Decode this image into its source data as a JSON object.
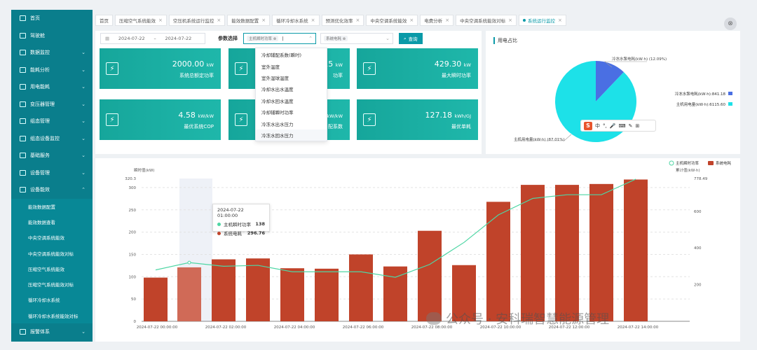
{
  "sidebar": {
    "items": [
      {
        "label": "首页",
        "icon": "home-icon"
      },
      {
        "label": "驾驶舱",
        "icon": "dashboard-icon"
      },
      {
        "label": "数据监控",
        "icon": "monitor-icon",
        "arrow": "⌄"
      },
      {
        "label": "能耗分析",
        "icon": "chart-icon",
        "arrow": "⌄"
      },
      {
        "label": "用电能耗",
        "icon": "power-icon",
        "arrow": "⌄"
      },
      {
        "label": "变压器管理",
        "icon": "transformer-icon",
        "arrow": "⌄"
      },
      {
        "label": "组态管理",
        "icon": "config-icon",
        "arrow": "⌄"
      },
      {
        "label": "组态设备监控",
        "icon": "device-icon",
        "arrow": "⌄"
      },
      {
        "label": "基础服务",
        "icon": "service-icon",
        "arrow": "⌄"
      },
      {
        "label": "设备管理",
        "icon": "equipment-icon",
        "arrow": "⌄"
      },
      {
        "label": "设备能效",
        "icon": "efficiency-icon",
        "arrow": "⌃"
      }
    ],
    "subitems": [
      {
        "label": "能效数据配置"
      },
      {
        "label": "能效数据查看"
      },
      {
        "label": "中央空调系统能效"
      },
      {
        "label": "中央空调系统能效对标"
      },
      {
        "label": "压缩空气系统能效"
      },
      {
        "label": "压缩空气系统能效对标"
      },
      {
        "label": "循环冷却水系统"
      },
      {
        "label": "循环冷却水系统能效对标"
      }
    ],
    "last": {
      "label": "报警体系",
      "icon": "alarm-icon",
      "arrow": "⌄"
    }
  },
  "tabs": [
    {
      "label": "首页",
      "close": ""
    },
    {
      "label": "压缩空气系统能效",
      "close": "×"
    },
    {
      "label": "空压机系统运行监控",
      "close": "×"
    },
    {
      "label": "能效数据配置",
      "close": "×"
    },
    {
      "label": "循环冷却水系统",
      "close": "×"
    },
    {
      "label": "预测优化效率",
      "close": "×"
    },
    {
      "label": "中央空调系统能效",
      "close": "×"
    },
    {
      "label": "电费分析",
      "close": "×"
    },
    {
      "label": "中央空调系统能效对标",
      "close": "×"
    },
    {
      "label": "系统运行监控",
      "close": "×",
      "active": true
    }
  ],
  "filters": {
    "start_date": "2024-07-22",
    "separator": "–",
    "end_date": "2024-07-22",
    "param_label": "参数选择",
    "param_chip": "主机瞬时功率 ⊗",
    "system_chip": "系统电耗 ⊗",
    "search_label": "查询"
  },
  "dropdown": {
    "options": [
      "冷却辅配系数(瞬时)",
      "室外温度",
      "室外湿球温度",
      "冷却水出水温度",
      "冷却水回水温度",
      "冷却辅瞬时功率",
      "冷冻水出水压力",
      "冷冻水回水压力"
    ]
  },
  "cards": [
    {
      "value": "2000.00",
      "unit": "kW",
      "label": "系统总额定功率"
    },
    {
      "value": "15",
      "unit": "kW",
      "label": "功率"
    },
    {
      "value": "429.30",
      "unit": "kW",
      "label": "最大瞬时功率"
    },
    {
      "value": "4.58",
      "unit": "kW/kW",
      "label": "最优系统COP"
    },
    {
      "value": "",
      "unit": "kW/kW",
      "label": "配系数"
    },
    {
      "value": "127.18",
      "unit": "kWh/GJ",
      "label": "最优单耗"
    }
  ],
  "pie": {
    "title": "用电占比",
    "label_small": "冷冻水泵电耗(kW·h) (12.09%)",
    "label_big": "主机用电量(kW·h) (87.01%)",
    "legend": [
      {
        "label": "冷冻水泵电耗(kW·h):841.18",
        "color": "#4a6fe3"
      },
      {
        "label": "主机用电量(kW·h):6115.60",
        "color": "#1de1e8"
      }
    ],
    "values": [
      841.18,
      6115.6
    ]
  },
  "ime": {
    "text": "中"
  },
  "chart_data": {
    "type": "bar",
    "legend": [
      {
        "name": "主机瞬时功率",
        "color": "#4ed6a4"
      },
      {
        "name": "系统电耗",
        "color": "#c0432a"
      }
    ],
    "ylabel_left": "瞬时值(kW)",
    "ylabel_right": "累计值(kW·h)",
    "y_left_max": "320.3",
    "y_right_max": "778.49",
    "y_left_ticks": [
      "300",
      "250",
      "200",
      "150",
      "100",
      "50",
      "0"
    ],
    "y_right_ticks": [
      "600",
      "400",
      "200"
    ],
    "x_labels": [
      "2024-07-22 00:00:00",
      "2024-07-22 02:00:00",
      "2024-07-22 04:00:00",
      "2024-07-22 06:00:00",
      "2024-07-22 08:00:00",
      "2024-07-22 10:00:00",
      "2024-07-22 12:00:00",
      "2024-07-22 14:00:00"
    ],
    "bars": [
      98,
      121,
      139,
      141,
      119,
      118,
      150,
      123,
      203,
      126,
      268,
      306,
      306,
      308,
      318
    ],
    "line": [
      280,
      320,
      300,
      305,
      270,
      270,
      270,
      240,
      310,
      430,
      580,
      670,
      690,
      690,
      775
    ],
    "tooltip": {
      "time": "2024-07-22 01:00:00",
      "series": [
        {
          "name": "主机瞬时功率",
          "value": "138"
        },
        {
          "name": "系统电耗",
          "value": "296.76"
        }
      ]
    }
  },
  "watermark": {
    "text": "公众号 · 安科瑞智慧能源管理"
  }
}
